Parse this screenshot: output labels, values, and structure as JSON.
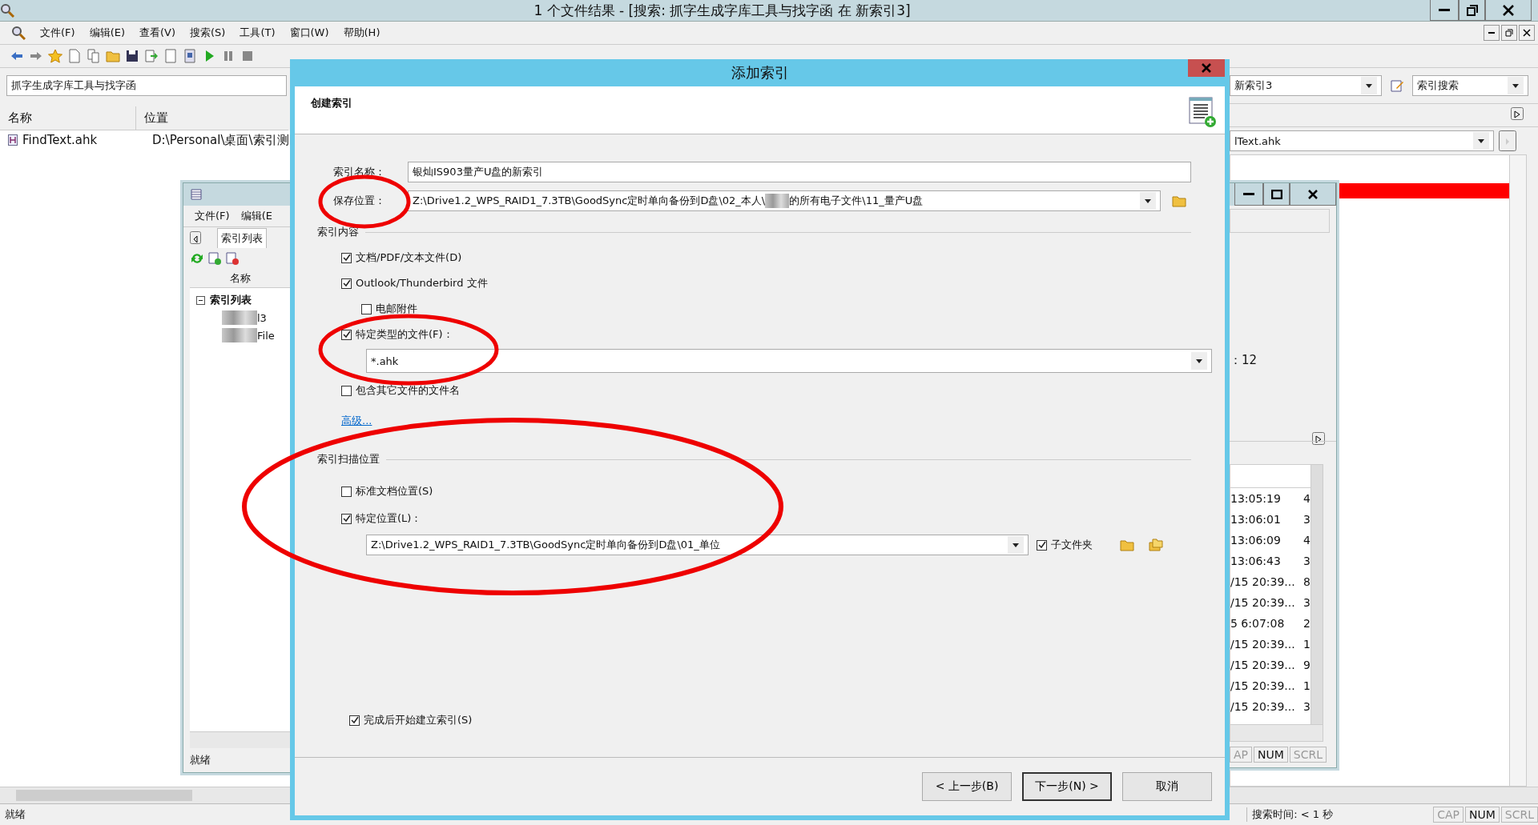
{
  "main_window": {
    "title": "1 个文件结果 - [搜索: 抓字生成字库工具与找字函 在 新索引3]"
  },
  "menu": [
    "文件(F)",
    "编辑(E)",
    "查看(V)",
    "搜索(S)",
    "工具(T)",
    "窗口(W)",
    "帮助(H)"
  ],
  "search": {
    "query": "抓字生成字库工具与找字函",
    "index": "新索引3",
    "mode": "索引搜索"
  },
  "results": {
    "columns": [
      "名称",
      "位置"
    ],
    "rows": [
      {
        "name": "FindText.ahk",
        "location": "D:\\Personal\\桌面\\索引测"
      }
    ]
  },
  "preview": {
    "file": "lText.ahk"
  },
  "status_bar": {
    "text": "就绪",
    "search_time": "搜索时间: < 1 秒",
    "indicators": [
      {
        "label": "CAP",
        "on": false
      },
      {
        "label": "NUM",
        "on": true
      },
      {
        "label": "SCRL",
        "on": false
      }
    ]
  },
  "index_manager": {
    "menu": [
      "文件(F)",
      "编辑(E"
    ],
    "tab": "索引列表",
    "column": "名称",
    "tree": [
      {
        "label": "索引列表",
        "expanded": true,
        "children": [
          {
            "label": "l3"
          },
          {
            "label": "File"
          }
        ]
      }
    ],
    "status": "就绪"
  },
  "log_window": {
    "count": "：12",
    "rows": [
      {
        "time": "13:05:19",
        "column_2": "4"
      },
      {
        "time": "13:06:01",
        "column_2": "3"
      },
      {
        "time": "13:06:09",
        "column_2": "4"
      },
      {
        "time": "13:06:43",
        "column_2": "3"
      },
      {
        "time": "/15 20:39...",
        "column_2": "8"
      },
      {
        "time": "/15 20:39...",
        "column_2": "3"
      },
      {
        "time": "5 6:07:08",
        "column_2": "2"
      },
      {
        "time": "/15 20:39...",
        "column_2": "1"
      },
      {
        "time": "/15 20:39...",
        "column_2": "9"
      },
      {
        "time": "/15 20:39...",
        "column_2": "1"
      },
      {
        "time": "/15 20:39...",
        "column_2": "3"
      }
    ],
    "indicators": [
      {
        "label": "AP",
        "on": false
      },
      {
        "label": "NUM",
        "on": true
      },
      {
        "label": "SCRL",
        "on": false
      }
    ]
  },
  "dialog": {
    "title": "添加索引",
    "heading": "创建索引",
    "name_label": "索引名称：",
    "name_value": "银灿IS903量产U盘的新索引",
    "save_label": "保存位置：",
    "save_path_start": "Z:\\Drive1.2_WPS_RAID1_7.3TB\\GoodSync定时单向备份到D盘\\02_本人\\",
    "save_path_end": "的所有电子文件\\11_量产U盘",
    "content_section": "索引内容",
    "content_options": [
      {
        "label": "文档/PDF/文本文件(D)",
        "checked": true
      },
      {
        "label": "Outlook/Thunderbird 文件",
        "checked": true,
        "children": [
          {
            "label": "电邮附件",
            "checked": false
          }
        ]
      },
      {
        "label": "特定类型的文件(F)：",
        "checked": true,
        "pattern": "*.ahk"
      },
      {
        "label": "包含其它文件的文件名",
        "checked": false
      }
    ],
    "advanced_link": "高级...",
    "scan_section": "索引扫描位置",
    "scan_options": [
      {
        "label": "标准文档位置(S)",
        "checked": false
      },
      {
        "label": "特定位置(L)：",
        "checked": true
      }
    ],
    "scan_path": "Z:\\Drive1.2_WPS_RAID1_7.3TB\\GoodSync定时单向备份到D盘\\01_单位",
    "subfolders": {
      "label": "子文件夹",
      "checked": true
    },
    "start_after": {
      "label": "完成后开始建立索引(S)",
      "checked": true
    },
    "buttons": [
      {
        "label": "< 上一步(B)",
        "default": false
      },
      {
        "label": "下一步(N) >",
        "default": true
      },
      {
        "label": "取消",
        "default": false
      }
    ]
  }
}
